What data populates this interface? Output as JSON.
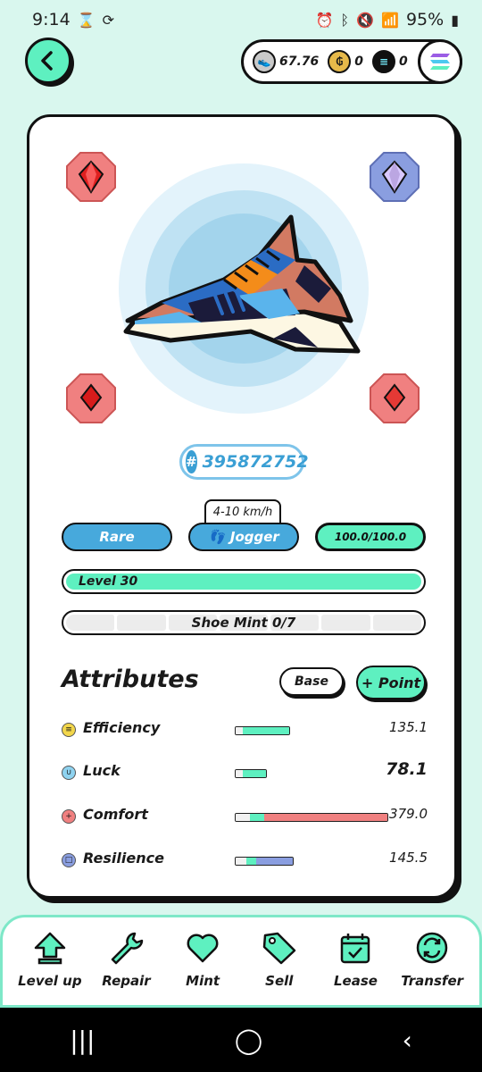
{
  "status_bar": {
    "time": "9:14",
    "battery": "95%"
  },
  "wallet": {
    "gst_amount": "67.76",
    "gmt_amount": "0",
    "sol_amount": "0"
  },
  "shoe": {
    "id": "395872752",
    "hash_symbol": "#",
    "rarity": "Rare",
    "type": "Jogger",
    "speed_range": "4-10 km/h",
    "durability": "100.0/100.0",
    "level": "Level 30",
    "level_fraction": 1.0,
    "mint": "Shoe Mint 0/7",
    "mint_count": 0,
    "mint_total": 7
  },
  "attributes": {
    "title": "Attributes",
    "base_label": "Base",
    "point_label": "+ Point",
    "items": [
      {
        "name": "Efficiency",
        "value": "135.1",
        "icon": "efficiency-icon",
        "color": "#5ef0c0",
        "icon_color": "#f2d64b"
      },
      {
        "name": "Luck",
        "value": "78.1",
        "icon": "luck-icon",
        "color": "#5ef0c0",
        "icon_color": "#8fd3f0"
      },
      {
        "name": "Comfort",
        "value": "379.0",
        "icon": "comfort-icon",
        "color": "#f08080",
        "icon_color": "#f08080"
      },
      {
        "name": "Resilience",
        "value": "145.5",
        "icon": "resilience-icon",
        "color": "#8a9ee0",
        "icon_color": "#8a9ee0"
      }
    ]
  },
  "bottom_nav": [
    {
      "label": "Level up",
      "icon": "level-up-icon"
    },
    {
      "label": "Repair",
      "icon": "wrench-icon"
    },
    {
      "label": "Mint",
      "icon": "heart-icon"
    },
    {
      "label": "Sell",
      "icon": "price-tag-icon"
    },
    {
      "label": "Lease",
      "icon": "calendar-check-icon"
    },
    {
      "label": "Transfer",
      "icon": "transfer-icon"
    }
  ],
  "colors": {
    "accent": "#5ef0c0",
    "rare_blue": "#47a9dc",
    "background": "#d9f7ee"
  }
}
